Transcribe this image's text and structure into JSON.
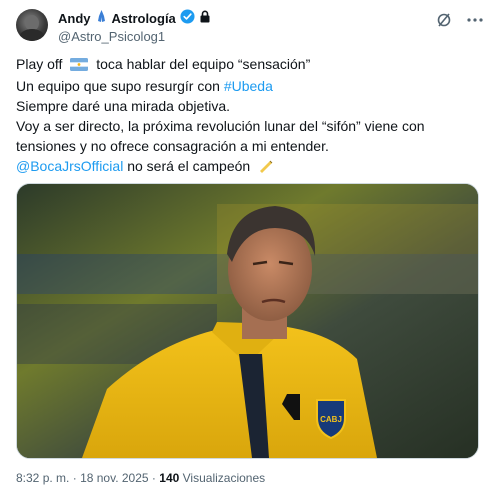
{
  "author": {
    "name": "Andy",
    "name_suffix": "Astrología",
    "handle": "@Astro_Psicolog1"
  },
  "tweet": {
    "lines": [
      {
        "pre": "Play off",
        "post": " toca hablar del equipo “sensación”"
      },
      {
        "pre": "Un equipo que supo resurgír con ",
        "hashtag": "#Ubeda"
      },
      {
        "text": "Siempre daré una mirada objetiva."
      },
      {
        "text": "Voy a ser directo, la próxima revolución lunar del “sifón” viene con"
      },
      {
        "text": "tensiones y no ofrece consagración a mi entender."
      },
      {
        "mention": "@BocaJrsOfficial",
        "post": " no será el campeón"
      }
    ]
  },
  "media": {
    "alt": "Hombre con chaqueta amarilla de Boca Juniors bajo la lluvia",
    "badge_text": "CABJ"
  },
  "meta": {
    "time": "8:32 p. m.",
    "separator": "·",
    "date": "18 nov. 2025",
    "views_count": "140",
    "views_label": "Visualizaciones"
  },
  "icons": [
    "pray-hands-icon",
    "verified-badge-icon",
    "lock-icon",
    "grok-icon",
    "more-icon",
    "argentina-flag-icon",
    "writing-hand-icon"
  ],
  "colors": {
    "link": "#1d9bf0",
    "verified": "#1d9bf0",
    "muted": "#536471",
    "text": "#0f1419"
  }
}
